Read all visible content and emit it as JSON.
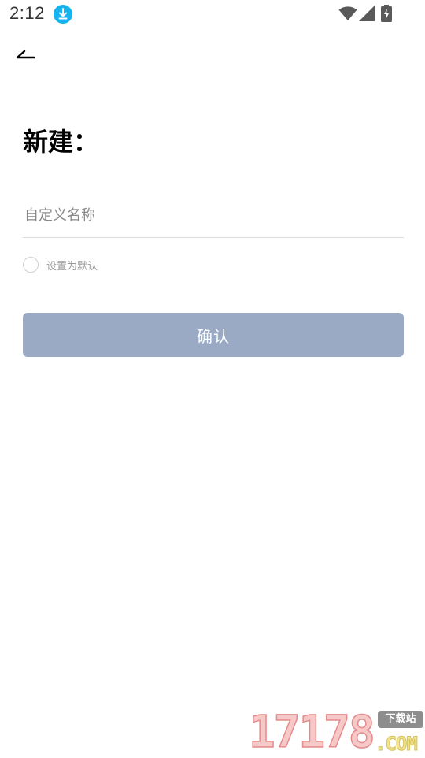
{
  "status_bar": {
    "time": "2:12",
    "icons": [
      "download-icon",
      "wifi-icon",
      "signal-icon",
      "battery-icon"
    ],
    "download_icon_color": "#16b4ee"
  },
  "header": {
    "back_icon": "back-arrow-icon"
  },
  "form": {
    "title": "新建：",
    "name_placeholder": "自定义名称",
    "name_value": "",
    "default_label": "设置为默认",
    "default_checked": false,
    "confirm_label": "确认",
    "confirm_color": "#9aaac4"
  },
  "watermark": {
    "digits": "17178",
    "badge": "下载站",
    "suffix": ".COM"
  }
}
